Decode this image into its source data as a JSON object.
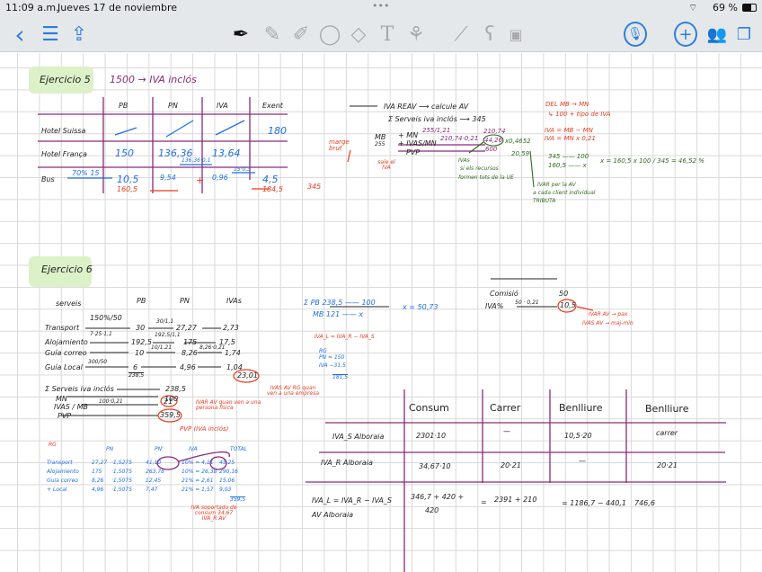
{
  "status_bar": {
    "time": "11:09 a.m.",
    "date": "Jueves 17 de noviembre",
    "battery": "69 %"
  },
  "toolbar": {
    "left": [
      "back-icon",
      "list-icon",
      "share-icon"
    ],
    "tools": [
      "pen-icon",
      "pencil-icon",
      "highlighter-icon",
      "lasso-icon",
      "eraser-icon",
      "text-icon",
      "shapes-icon",
      "ruler-icon",
      "elements-icon",
      "image-icon"
    ],
    "right": [
      "microphone-icon",
      "add-page-icon",
      "collaborate-icon",
      "pages-icon"
    ]
  },
  "colors": {
    "ink": "#222222",
    "purple": "#8a2a7a",
    "blue": "#1f6fe8",
    "red": "#ea3a1e",
    "green": "#2e6b1e",
    "highlight": "#dcf1c8"
  },
  "ex5": {
    "title": "Ejercicio 5",
    "subtitle": "1500 → IVA inclós",
    "headers": [
      "PB",
      "PN",
      "IVA",
      "Exent"
    ],
    "rows": [
      {
        "label": "Hotel Suissa",
        "exent": "180"
      },
      {
        "label": "Hotel França",
        "pb": "150",
        "pn": "136,36",
        "iva": "13,64",
        "note": "136,36·0,1"
      },
      {
        "label": "Bus",
        "arrow": "70% 15",
        "pb": "10,5",
        "pb_total": "160,5",
        "pn": "9,54",
        "plus": "+",
        "iva": "0,96",
        "iva_note": "15·0,3",
        "exent": "4,5",
        "exent_total": "184,5"
      }
    ],
    "side": "345",
    "notes": {
      "l1": "IVA REAV ⟶ calcule AV",
      "l2": "Σ Serveis iva inclós ⟶ 345",
      "mb": "MB",
      "mb_val": "255",
      "pn": "+ MN",
      "ivas": "+ IVAS/MN",
      "pvp": "PVP",
      "n1": "255/1,21",
      "n2": "210,74·0,21",
      "n3": "210,74",
      "n4": "44,26",
      "n5": "x0,4652",
      "n6": "600",
      "n7": "20,59",
      "margen": "marge brut",
      "sale": "sale el IVA",
      "green1": "IVAs",
      "green2": "si els recursos",
      "green3": "formen tots de la UE",
      "green4": "IVAR per la AV",
      "green5": "a cada client individual",
      "green6": "TRIBUTA",
      "r1": "DEL MB → MN",
      "r2": "↳ 100 + tipo de IVA",
      "r3": "IVA = MB − MN",
      "r4": "IVA = MN x 0,21",
      "p1": "345 —— 100",
      "p2": "160,5 —— x",
      "p3": "x = 160,5 x 100 / 345 = 46,52 %"
    }
  },
  "ex6": {
    "title": "Ejercicio 6",
    "headers": [
      "serveis",
      "PB",
      "PN",
      "IVAs"
    ],
    "rows": [
      {
        "label": "Transport",
        "op": "150%/50",
        "pb": "30",
        "op2": "30/1,1",
        "pn": "27,27",
        "iva": "2,73"
      },
      {
        "label": "Alojamiento",
        "op": "7·25·1,1",
        "pb": "192,5",
        "op2": "192,5/1,1",
        "pn": "175",
        "iva": "17,5"
      },
      {
        "label": "Guía correo",
        "pb": "10",
        "op2": "10/1,21",
        "pn": "8,26",
        "op3": "8,26·0,21",
        "iva": "1,74"
      },
      {
        "label": "Guía Local",
        "op": "300/50",
        "pb": "6",
        "pn": "4,96",
        "iva": "1,04"
      }
    ],
    "pb_total": "238,5",
    "iva_total": "23,01",
    "iva_note": "IVAS AV RG quan ven a una empresa",
    "sum": {
      "l1": "Σ Serveis iva inclós",
      "v1": "238,5",
      "l2": "MN",
      "v2": "100",
      "l3": "IVAS / MB",
      "op3": "100·0,21",
      "v3": "21",
      "l4": "PVP",
      "v4": "359,5"
    },
    "ivar_note": "IVAR AV quan ven a una persona física",
    "pvp_note": "PVP (IVA inclós)",
    "calc": {
      "l1": "Σ PB   238,5 —— 100",
      "l2": "MB   121 —— x",
      "x": "x = 50,73",
      "f": "IVA_L = IVA_R − IVA_S",
      "rg": "RG",
      "pn": "PN = 150",
      "iva": "IVA  −31,5",
      "tot": "181,5"
    },
    "comisio": {
      "l1": "Comisió",
      "v1": "50",
      "l2": "IVA%",
      "op": "50 · 0,21",
      "v2": "10,5",
      "n1": "IVAR AV → pax",
      "n2": "IVAS AV → maj-min"
    },
    "rg": {
      "title": "RG",
      "headers": [
        "PN",
        "PN'",
        "IVA",
        "TOTAL"
      ],
      "rows": [
        {
          "label": "Transport",
          "pn": "27,27",
          "op": "·1,5275",
          "pn2": "41,10",
          "iva": "10% = 4,11",
          "total": "45,25"
        },
        {
          "label": "Alojamiento",
          "pn": "175",
          "op": "·1,5075",
          "pn2": "263,78",
          "iva": "10% = 26,38",
          "total": "290,16"
        },
        {
          "label": "Guía correo",
          "pn": "8,26",
          "op": "·1,5075",
          "pn2": "12,45",
          "iva": "21% = 2,61",
          "total": "15,06"
        },
        {
          "label": "+ Local",
          "pn": "4,96",
          "op": "·1,5075",
          "pn2": "7,47",
          "iva": "21% = 1,57",
          "total": "9,03"
        }
      ],
      "total": "359,5",
      "note": "IVA soportado de consum 34,67 IVA_R AV"
    },
    "table": {
      "headers": [
        "Consum",
        "Carrer",
        "Benlliure",
        "Benlliure"
      ],
      "rows": [
        {
          "label": "IVA_S Alboraia",
          "cells": [
            "2301·10",
            "—",
            "10,5·20",
            "carrer"
          ]
        },
        {
          "label": "IVA_R Alboraia",
          "cells": [
            "34,67·10",
            "20·21",
            "—",
            "20·21"
          ]
        }
      ],
      "formula": "IVA_L = IVA_R − IVA_S",
      "formula2": "AV Alboraia",
      "c1": "346,7 + 420 +",
      "c1b": "420",
      "eq": "=",
      "c2": "2391 + 210",
      "c3": "= 1186,7 − 440,1",
      "c4": "746,6"
    }
  }
}
